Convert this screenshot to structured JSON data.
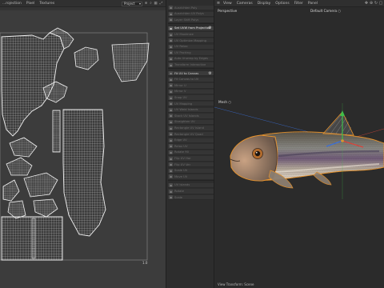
{
  "uv_editor": {
    "menu": [
      "...rojection",
      "Pixel",
      "Textures"
    ],
    "dropdown_value": "Project",
    "scale_label": "1.0"
  },
  "command_panel": {
    "items": [
      {
        "label": "Ausrichten Poly",
        "state": "dim"
      },
      {
        "label": "Ausrichten UV Polys",
        "state": "dim"
      },
      {
        "label": "Layer Shift Polys",
        "state": "dim"
      },
      {
        "label": "Set UVW from Projection",
        "state": "active"
      },
      {
        "label": "UV Maximize",
        "state": "dim"
      },
      {
        "label": "UV Optimize Mapping",
        "state": "dim"
      },
      {
        "label": "UV Relax",
        "state": "dim"
      },
      {
        "label": "UV Packing",
        "state": "dim"
      },
      {
        "label": "Auto Unwrap by Edges",
        "state": "dim"
      },
      {
        "label": "Transform Interactive",
        "state": "dim"
      },
      {
        "label": "Fit UV to Canvas",
        "state": "header"
      },
      {
        "label": "Fit Canvas to UV",
        "state": "dim"
      },
      {
        "label": "Mirror U",
        "state": "dim"
      },
      {
        "label": "Mirror V",
        "state": "dim"
      },
      {
        "label": "Snap UV",
        "state": "dim"
      },
      {
        "label": "UV Mapping",
        "state": "dim"
      },
      {
        "label": "UV Weld Islands",
        "state": "dim"
      },
      {
        "label": "Stack UV Islands",
        "state": "dim"
      },
      {
        "label": "Straighten UV",
        "state": "dim"
      },
      {
        "label": "Rectangle UV Island",
        "state": "dim"
      },
      {
        "label": "Rectangle UV Quad",
        "state": "dim"
      },
      {
        "label": "Edge UV",
        "state": "dim"
      },
      {
        "label": "Relax UV",
        "state": "dim"
      },
      {
        "label": "Rotate 90",
        "state": "dim"
      },
      {
        "label": "Flip UV Hor",
        "state": "dim"
      },
      {
        "label": "Flip UV Ver",
        "state": "dim"
      },
      {
        "label": "Scale UV",
        "state": "dim"
      },
      {
        "label": "Move UV",
        "state": "dim"
      },
      {
        "label": "UV Islands",
        "state": "dim"
      },
      {
        "label": "Rotate",
        "state": "dim"
      },
      {
        "label": "Scale",
        "state": "dim"
      }
    ]
  },
  "viewport": {
    "menu": [
      "View",
      "Cameras",
      "Display",
      "Options",
      "Filter",
      "Panel"
    ],
    "perspective_label": "Perspective",
    "camera_label": "Default Camera ○",
    "object_label": "Mesh ○",
    "bottom_label": "View Transform: Scene"
  },
  "colors": {
    "accent_orange": "#e8932c",
    "axis_green": "#3fbf4a",
    "axis_blue": "#3a6fd8",
    "axis_red": "#d8443a",
    "uv_line": "#e6e6e6"
  },
  "icons": {
    "uv_toolbar": [
      "magnet-icon",
      "search-icon",
      "grid-icon",
      "expand-icon"
    ],
    "viewport_menu": [
      "menu-icon"
    ],
    "viewport_corner": [
      "move-icon",
      "zoom-icon",
      "rotate-icon",
      "maximize-icon"
    ]
  }
}
